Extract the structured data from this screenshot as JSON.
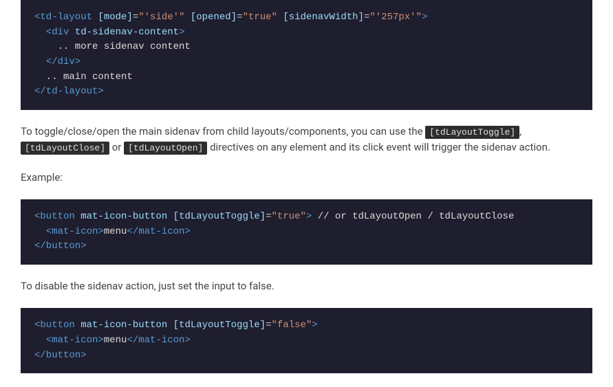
{
  "codeBlocks": {
    "block1": {
      "line1": {
        "open": "<td-layout",
        "a1n": "[mode]",
        "eq": "=",
        "a1v": "\"'side'\"",
        "a2n": "[opened]",
        "a2v": "\"true\"",
        "a3n": "[sidenavWidth]",
        "a3v": "\"'257px'\"",
        "close": ">"
      },
      "line2": {
        "open": "  <div",
        "attr": " td-sidenav-content",
        "close": ">"
      },
      "line3": "    .. more sidenav content",
      "line4": "  </div>",
      "line5": "  .. main content",
      "line6": "</td-layout>"
    },
    "block2": {
      "line1": {
        "open": "<button",
        "attr1": " mat-icon-button",
        "a2n": " [tdLayoutToggle]",
        "a2v": "\"true\"",
        "close": ">",
        "comment": " // or tdLayoutOpen / tdLayoutClose"
      },
      "line2": {
        "open": "  <mat-icon>",
        "content": "menu",
        "close": "</mat-icon>"
      },
      "line3": "</button>"
    },
    "block3": {
      "line1": {
        "open": "<button",
        "attr1": " mat-icon-button",
        "a2n": " [tdLayoutToggle]",
        "a2v": "\"false\"",
        "close": ">"
      },
      "line2": {
        "open": "  <mat-icon>",
        "content": "menu",
        "close": "</mat-icon>"
      },
      "line3": "</button>"
    }
  },
  "prose": {
    "p1_before": "To toggle/close/open the main sidenav from child layouts/components, you can use the ",
    "p1_code1": "[tdLayoutToggle]",
    "p1_mid1": ", ",
    "p1_code2": "[tdLayoutClose]",
    "p1_mid2": " or ",
    "p1_code3": "[tdLayoutOpen]",
    "p1_after": " directives on any element and its click event will trigger the sidenav action.",
    "p2": "Example:",
    "p3": "To disable the sidenav action, just set the input to false."
  }
}
